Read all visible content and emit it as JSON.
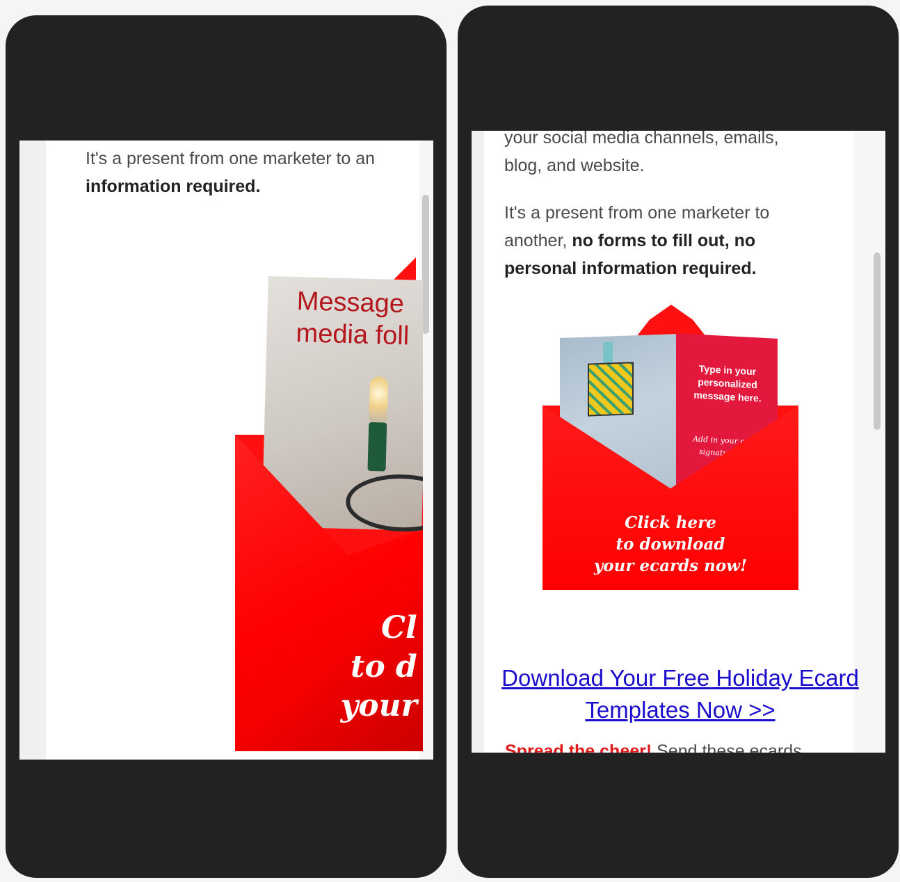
{
  "left_screen": {
    "intro_line": "It's a present from one marketer to an",
    "intro_bold": "information required.",
    "card_text": "Message\nmedia foll",
    "cta_lines": [
      "Cl",
      "to d",
      "your"
    ]
  },
  "right_screen": {
    "para1_line": "your social media channels, emails,",
    "para1_line2": "blog, and website.",
    "para2_line1": "It's a present from one marketer to",
    "para2_line2_plain": "another, ",
    "para2_line2_bold": "no forms to fill out, no",
    "para2_line3_bold": "personal information required.",
    "card_text": "Type in your personalized message here.",
    "card_signature": "Add in your ecard signature here",
    "cta": "Click here\nto download\nyour ecards now!",
    "download_link": "Download Your Free Holiday Ecard Templates Now >>",
    "spread_bold": "Spread the cheer!",
    "spread_rest": " Send these ecards"
  },
  "colors": {
    "envelope_red": "#ff1010",
    "link_blue": "#1a0dcc",
    "card_text_red": "#b3161c",
    "card_pink": "#e2183d",
    "bezel": "#222222"
  }
}
